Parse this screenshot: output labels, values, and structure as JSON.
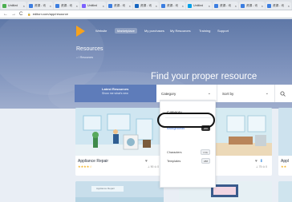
{
  "browser": {
    "tabs": [
      {
        "label": "Untitled",
        "color": "#4caf50"
      },
      {
        "label": "资源 - 讯",
        "color": "#3b7de0"
      },
      {
        "label": "资源 - 讯",
        "color": "#3b7de0"
      },
      {
        "label": "Untitled",
        "color": "#7b61ff"
      },
      {
        "label": "资源 - 讯",
        "color": "#3b7de0"
      },
      {
        "label": "资源 - 讯",
        "color": "#1565c0"
      },
      {
        "label": "资源 - 讯",
        "color": "#3b7de0"
      },
      {
        "label": "Untitled",
        "color": "#00a0e9"
      },
      {
        "label": "资源 - 讯",
        "color": "#3b7de0"
      },
      {
        "label": "资源 - 讯",
        "color": "#3b7de0"
      },
      {
        "label": "资源 - 讯",
        "color": "#3b7de0"
      }
    ],
    "url": "editorr.com/app/resource",
    "back": "←",
    "forward": "→",
    "reload": "C"
  },
  "site": {
    "nav": [
      "Website",
      "Marketplace",
      "My purchases",
      "My Resources",
      "Training",
      "Support"
    ],
    "active_nav": 1,
    "page_title": "Resources",
    "breadcrumb": "⌂  /  Resources",
    "hero_headline": "Find your proper resource",
    "brand_color": "#f7a21b"
  },
  "filters": {
    "latest_title": "Latest Resources",
    "latest_sub": "Show me what's new",
    "category_label": "Category",
    "sort_label": "Sort by",
    "chevron": "⌄",
    "search_icon": "search-icon"
  },
  "dropdown": {
    "heading": "Category",
    "items": [
      {
        "label": "Backgrounds",
        "count": "200"
      },
      {
        "label": "Characters",
        "count": "2.1k"
      },
      {
        "label": "Templates",
        "count": "288"
      }
    ]
  },
  "cards": [
    {
      "title": "Appliance Repair",
      "stars": "★★★★☆",
      "stats": "⊥ 90  ⊙ 0"
    },
    {
      "title": "",
      "stars": "★★★★☆",
      "stats": "⊥ 75  ⊙ 0"
    },
    {
      "title": "Appl",
      "stars": "★★",
      "stats": ""
    }
  ],
  "bottom_cards": [
    {
      "title": "Appliance Repair"
    }
  ]
}
